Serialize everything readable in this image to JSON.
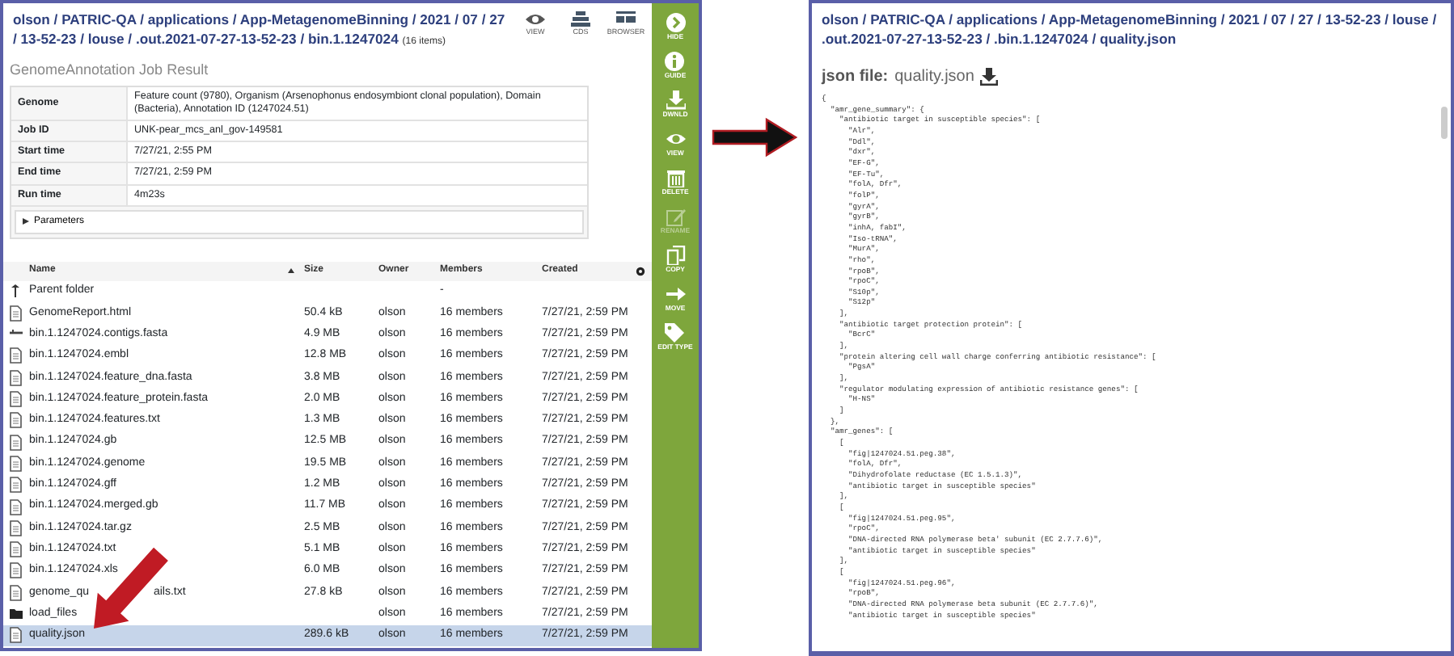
{
  "left_panel": {
    "breadcrumb": {
      "path": "olson / PATRIC-QA / applications / App-MetagenomeBinning / 2021 / 07 / 27 / 13-52-23 / louse / .out.2021-07-27-13-52-23 / bin.1.1247024",
      "count": "(16 items)"
    },
    "view_actions": [
      {
        "label": "VIEW",
        "kind": "eye"
      },
      {
        "label": "CDS",
        "kind": "cds"
      },
      {
        "label": "BROWSER",
        "kind": "browser"
      }
    ],
    "job_title": "GenomeAnnotation Job Result",
    "job_details": [
      {
        "label": "Genome",
        "value": "Feature count (9780), Organism (Arsenophonus endosymbiont clonal population), Domain (Bacteria), Annotation ID (1247024.51)"
      },
      {
        "label": "Job ID",
        "value": "UNK-pear_mcs_anl_gov-149581"
      },
      {
        "label": "Start time",
        "value": "7/27/21, 2:55 PM"
      },
      {
        "label": "End time",
        "value": "7/27/21, 2:59 PM"
      },
      {
        "label": "Run time",
        "value": "4m23s"
      }
    ],
    "parameters": {
      "label": "Parameters",
      "expanded": false
    },
    "file_table": {
      "columns": [
        {
          "label": "Name",
          "sort_ascending": true
        },
        {
          "label": "Size"
        },
        {
          "label": "Owner"
        },
        {
          "label": "Members"
        },
        {
          "label": "Created"
        }
      ],
      "rows": [
        {
          "kind": "parent",
          "name": "Parent folder",
          "members": "-",
          "selected": false
        },
        {
          "kind": "file",
          "name": "GenomeReport.html",
          "size": "50.4 kB",
          "owner": "olson",
          "members": "16 members",
          "created": "7/27/21, 2:59 PM",
          "selected": false
        },
        {
          "kind": "contigs",
          "name": "bin.1.1247024.contigs.fasta",
          "size": "4.9 MB",
          "owner": "olson",
          "members": "16 members",
          "created": "7/27/21, 2:59 PM",
          "selected": false
        },
        {
          "kind": "file",
          "name": "bin.1.1247024.embl",
          "size": "12.8 MB",
          "owner": "olson",
          "members": "16 members",
          "created": "7/27/21, 2:59 PM",
          "selected": false
        },
        {
          "kind": "file",
          "name": "bin.1.1247024.feature_dna.fasta",
          "size": "3.8 MB",
          "owner": "olson",
          "members": "16 members",
          "created": "7/27/21, 2:59 PM",
          "selected": false
        },
        {
          "kind": "file",
          "name": "bin.1.1247024.feature_protein.fasta",
          "size": "2.0 MB",
          "owner": "olson",
          "members": "16 members",
          "created": "7/27/21, 2:59 PM",
          "selected": false
        },
        {
          "kind": "file",
          "name": "bin.1.1247024.features.txt",
          "size": "1.3 MB",
          "owner": "olson",
          "members": "16 members",
          "created": "7/27/21, 2:59 PM",
          "selected": false
        },
        {
          "kind": "file",
          "name": "bin.1.1247024.gb",
          "size": "12.5 MB",
          "owner": "olson",
          "members": "16 members",
          "created": "7/27/21, 2:59 PM",
          "selected": false
        },
        {
          "kind": "file",
          "name": "bin.1.1247024.genome",
          "size": "19.5 MB",
          "owner": "olson",
          "members": "16 members",
          "created": "7/27/21, 2:59 PM",
          "selected": false
        },
        {
          "kind": "file",
          "name": "bin.1.1247024.gff",
          "size": "1.2 MB",
          "owner": "olson",
          "members": "16 members",
          "created": "7/27/21, 2:59 PM",
          "selected": false
        },
        {
          "kind": "file",
          "name": "bin.1.1247024.merged.gb",
          "size": "11.7 MB",
          "owner": "olson",
          "members": "16 members",
          "created": "7/27/21, 2:59 PM",
          "selected": false
        },
        {
          "kind": "file",
          "name": "bin.1.1247024.tar.gz",
          "size": "2.5 MB",
          "owner": "olson",
          "members": "16 members",
          "created": "7/27/21, 2:59 PM",
          "selected": false
        },
        {
          "kind": "file",
          "name": "bin.1.1247024.txt",
          "size": "5.1 MB",
          "owner": "olson",
          "members": "16 members",
          "created": "7/27/21, 2:59 PM",
          "selected": false
        },
        {
          "kind": "file",
          "name": "bin.1.1247024.xls",
          "size": "6.0 MB",
          "owner": "olson",
          "members": "16 members",
          "created": "7/27/21, 2:59 PM",
          "selected": false
        },
        {
          "kind": "file",
          "name": "genome_qu",
          "name_tail": "ails.txt",
          "size": "27.8 kB",
          "owner": "olson",
          "members": "16 members",
          "created": "7/27/21, 2:59 PM",
          "selected": false
        },
        {
          "kind": "folder",
          "name": "load_files",
          "owner": "olson",
          "members": "16 members",
          "created": "7/27/21, 2:59 PM",
          "selected": false
        },
        {
          "kind": "file",
          "name": "quality.json",
          "size": "289.6 kB",
          "owner": "olson",
          "members": "16 members",
          "created": "7/27/21, 2:59 PM",
          "selected": true
        }
      ]
    },
    "sidebar": [
      {
        "label": "HIDE",
        "kind": "hide",
        "disabled": false
      },
      {
        "label": "GUIDE",
        "kind": "guide",
        "disabled": false
      },
      {
        "label": "DWNLD",
        "kind": "download",
        "disabled": false
      },
      {
        "label": "VIEW",
        "kind": "view",
        "disabled": false
      },
      {
        "label": "DELETE",
        "kind": "delete",
        "disabled": false
      },
      {
        "label": "RENAME",
        "kind": "rename",
        "disabled": true
      },
      {
        "label": "COPY",
        "kind": "copy",
        "disabled": false
      },
      {
        "label": "MOVE",
        "kind": "move",
        "disabled": false
      },
      {
        "label": "EDIT TYPE",
        "kind": "edit_type",
        "disabled": false
      }
    ]
  },
  "right_panel": {
    "breadcrumb": "olson / PATRIC-QA / applications / App-MetagenomeBinning / 2021 / 07 / 27 / 13-52-23 / louse / .out.2021-07-27-13-52-23 / .bin.1.1247024 / quality.json",
    "file_heading": {
      "label": "json file:",
      "filename": "quality.json"
    },
    "json_lines": [
      "{",
      "  \"amr_gene_summary\": {",
      "    \"antibiotic target in susceptible species\": [",
      "      \"Alr\",",
      "      \"Ddl\",",
      "      \"dxr\",",
      "      \"EF-G\",",
      "      \"EF-Tu\",",
      "      \"folA, Dfr\",",
      "      \"folP\",",
      "      \"gyrA\",",
      "      \"gyrB\",",
      "      \"inhA, fabI\",",
      "      \"Iso-tRNA\",",
      "      \"MurA\",",
      "      \"rho\",",
      "      \"rpoB\",",
      "      \"rpoC\",",
      "      \"S10p\",",
      "      \"S12p\"",
      "    ],",
      "    \"antibiotic target protection protein\": [",
      "      \"BcrC\"",
      "    ],",
      "    \"protein altering cell wall charge conferring antibiotic resistance\": [",
      "      \"PgsA\"",
      "    ],",
      "    \"regulator modulating expression of antibiotic resistance genes\": [",
      "      \"H-NS\"",
      "    ]",
      "  },",
      "  \"amr_genes\": [",
      "    [",
      "      \"fig|1247024.51.peg.38\",",
      "      \"folA, Dfr\",",
      "      \"Dihydrofolate reductase (EC 1.5.1.3)\",",
      "      \"antibiotic target in susceptible species\"",
      "    ],",
      "    [",
      "      \"fig|1247024.51.peg.95\",",
      "      \"rpoC\",",
      "      \"DNA-directed RNA polymerase beta' subunit (EC 2.7.7.6)\",",
      "      \"antibiotic target in susceptible species\"",
      "    ],",
      "    [",
      "      \"fig|1247024.51.peg.96\",",
      "      \"rpoB\",",
      "      \"DNA-directed RNA polymerase beta subunit (EC 2.7.7.6)\",",
      "      \"antibiotic target in susceptible species\""
    ]
  }
}
